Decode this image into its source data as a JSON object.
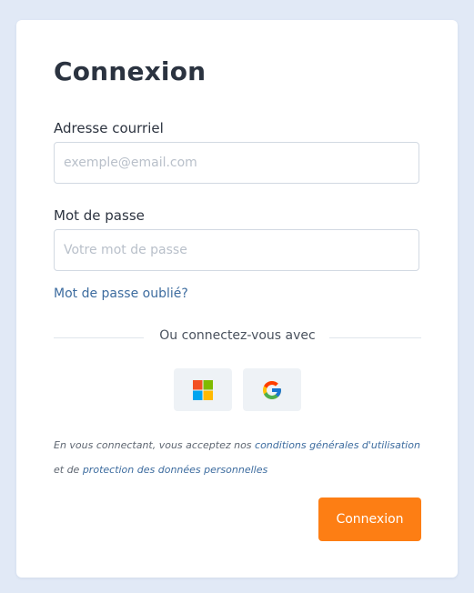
{
  "login": {
    "title": "Connexion",
    "email_label": "Adresse courriel",
    "email_placeholder": "exemple@email.com",
    "email_value": "",
    "password_label": "Mot de passe",
    "password_placeholder": "Votre mot de passe",
    "password_value": "",
    "forgot_link": "Mot de passe oublié?",
    "divider_text": "Ou connectez-vous avec",
    "social_providers": [
      "microsoft-icon",
      "google-icon"
    ],
    "terms_prefix": "En vous connectant, vous acceptez nos ",
    "terms_link": "conditions générales d'utilisation",
    "terms_middle": " et de ",
    "privacy_link": "protection des données personnelles",
    "submit_label": "Connexion"
  },
  "colors": {
    "background": "#e1e9f6",
    "card": "#ffffff",
    "accent": "#fd7e14",
    "link": "#3d6c9f",
    "text": "#2b3340"
  }
}
